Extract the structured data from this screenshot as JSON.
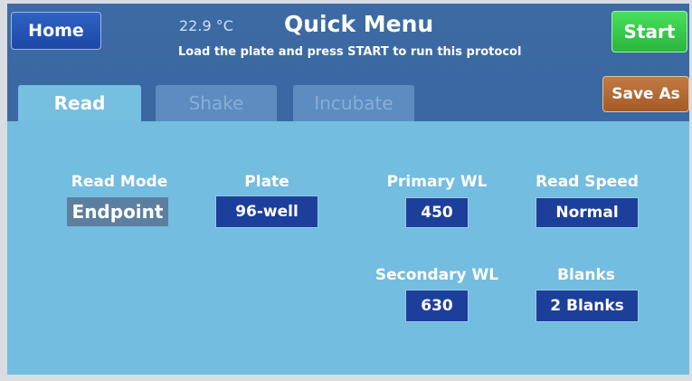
{
  "header": {
    "home_label": "Home",
    "temperature": "22.9 °C",
    "title": "Quick Menu",
    "subtitle": "Load the plate and press START to run this protocol",
    "start_label": "Start",
    "save_as_label": "Save As"
  },
  "tabs": [
    {
      "label": "Read",
      "active": true
    },
    {
      "label": "Shake",
      "active": false
    },
    {
      "label": "Incubate",
      "active": false
    }
  ],
  "settings": {
    "read_mode": {
      "label": "Read Mode",
      "value": "Endpoint"
    },
    "plate": {
      "label": "Plate",
      "value": "96-well"
    },
    "primary_wl": {
      "label": "Primary WL",
      "value": "450"
    },
    "read_speed": {
      "label": "Read Speed",
      "value": "Normal"
    },
    "secondary_wl": {
      "label": "Secondary WL",
      "value": "630"
    },
    "blanks": {
      "label": "Blanks",
      "value": "2 Blanks"
    }
  },
  "colors": {
    "start": "#3cc84d",
    "save_as": "#b06a35",
    "home": "#2555b5",
    "panel": "#72bde0",
    "value_box": "#1d3f9c"
  }
}
